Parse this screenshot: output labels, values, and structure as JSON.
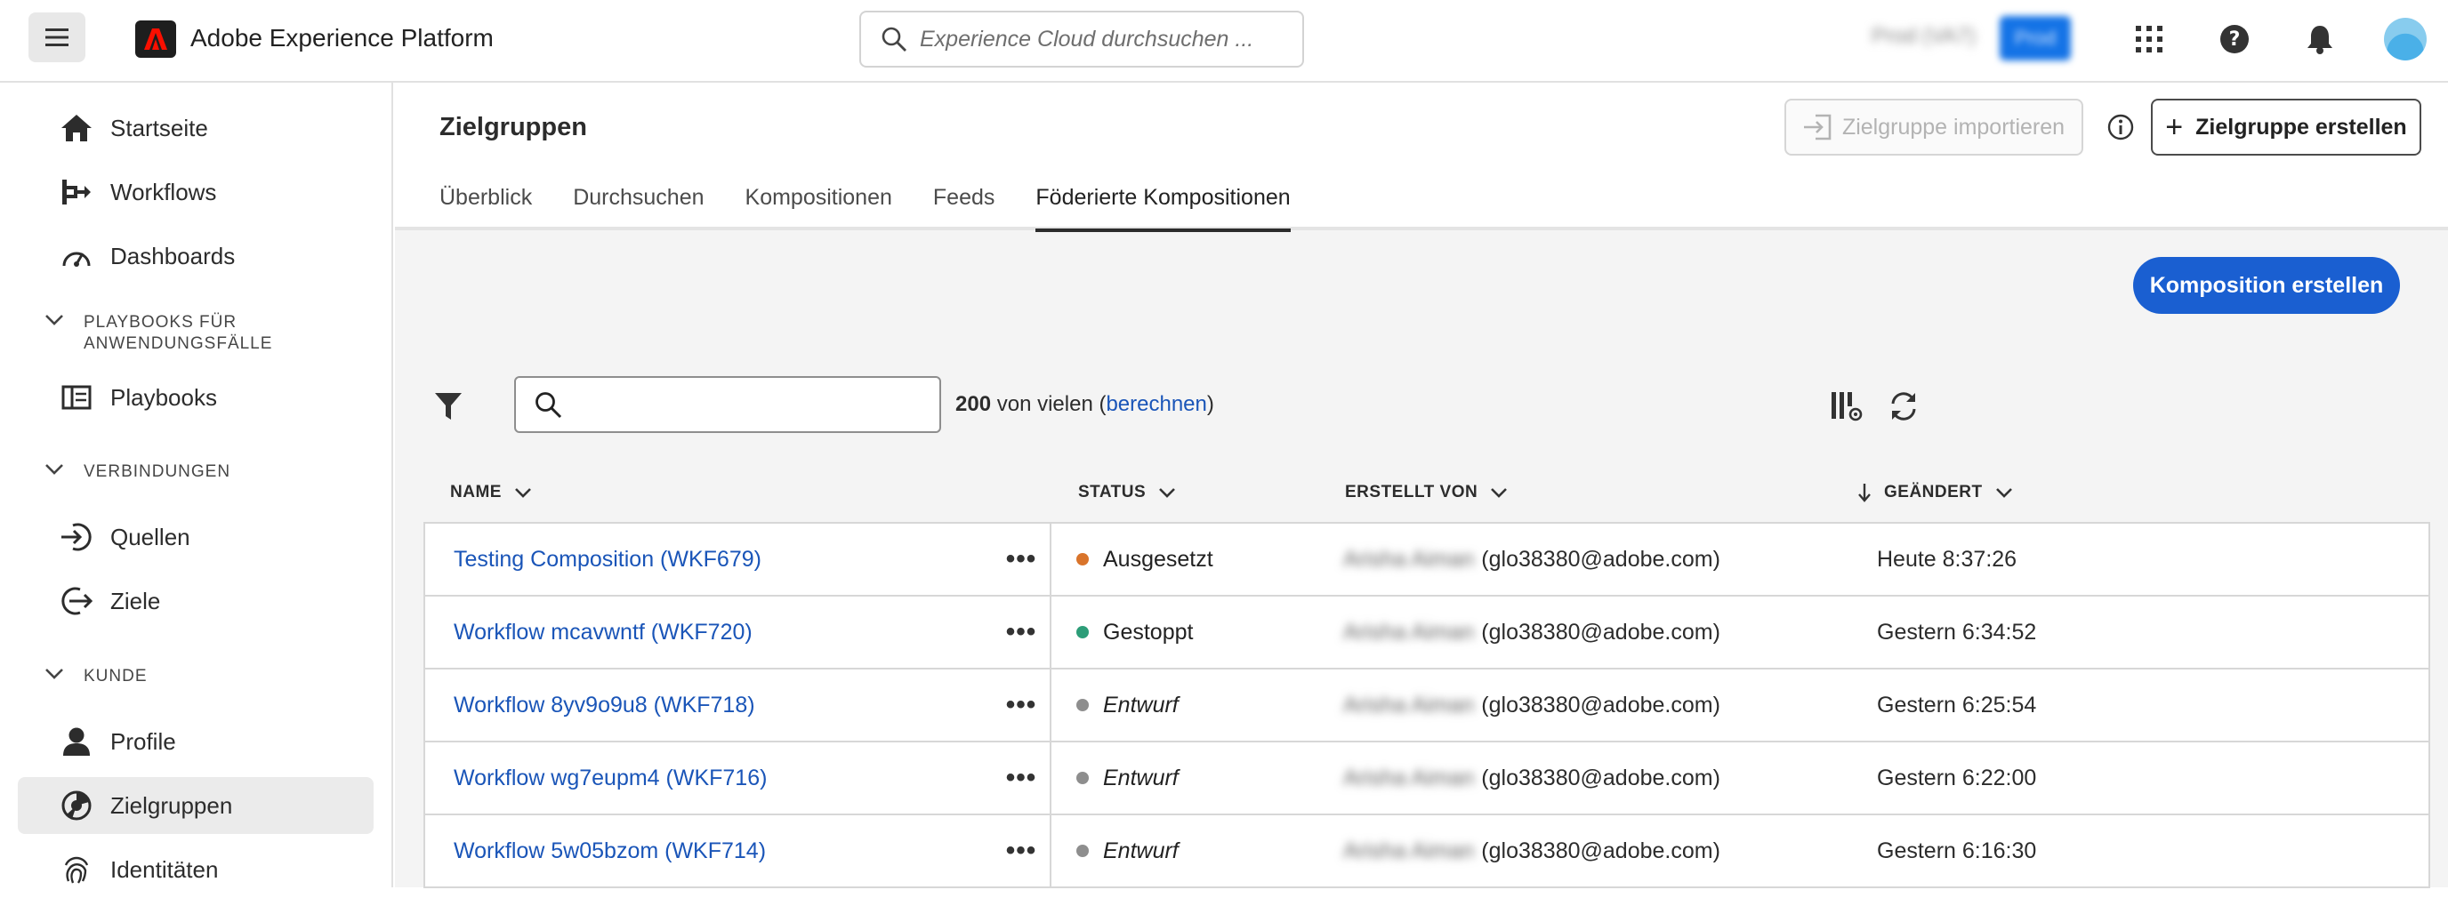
{
  "app": {
    "title": "Adobe Experience Platform"
  },
  "topbar": {
    "search_placeholder": "Experience Cloud durchsuchen ...",
    "org_label": "Prod (VA7)",
    "org_badge": "Prod"
  },
  "sidebar": {
    "items": [
      {
        "label": "Startseite",
        "icon": "home-icon"
      },
      {
        "label": "Workflows",
        "icon": "workflow-icon"
      },
      {
        "label": "Dashboards",
        "icon": "dashboard-icon"
      }
    ],
    "section_playbooks": "PLAYBOOKS FÜR ANWENDUNGSFÄLLE",
    "playbooks": {
      "label": "Playbooks",
      "icon": "playbook-icon"
    },
    "section_connections": "VERBINDUNGEN",
    "sources": {
      "label": "Quellen",
      "icon": "sources-icon"
    },
    "destinations": {
      "label": "Ziele",
      "icon": "destinations-icon"
    },
    "section_customer": "KUNDE",
    "profiles": {
      "label": "Profile",
      "icon": "profile-icon"
    },
    "audiences": {
      "label": "Zielgruppen",
      "icon": "audiences-icon"
    },
    "identities": {
      "label": "Identitäten",
      "icon": "fingerprint-icon"
    }
  },
  "main": {
    "title": "Zielgruppen",
    "import_label": "Zielgruppe importieren",
    "create_audience_label": "Zielgruppe erstellen",
    "tabs": [
      {
        "label": "Überblick"
      },
      {
        "label": "Durchsuchen"
      },
      {
        "label": "Kompositionen"
      },
      {
        "label": "Feeds"
      },
      {
        "label": "Föderierte Kompositionen"
      }
    ],
    "active_tab": "Föderierte Kompositionen",
    "create_composition_label": "Komposition erstellen",
    "count_bold": "200",
    "count_text": " von vielen (",
    "count_link": "berechnen",
    "count_close": ")",
    "columns": {
      "name": "NAME",
      "status": "STATUS",
      "created_by": "ERSTELLT VON",
      "changed": "GEÄNDERT"
    },
    "rows": [
      {
        "name": "Testing Composition (WKF679)",
        "status": "Ausgesetzt",
        "status_color": "#d9742b",
        "italic": false,
        "creator_name": "Arisha Aiman",
        "creator_email": "(glo38380@adobe.com)",
        "changed": "Heute 8:37:26"
      },
      {
        "name": "Workflow mcavwntf (WKF720)",
        "status": "Gestoppt",
        "status_color": "#2d9d78",
        "italic": false,
        "creator_name": "Arisha Aiman",
        "creator_email": "(glo38380@adobe.com)",
        "changed": "Gestern 6:34:52"
      },
      {
        "name": "Workflow 8yv9o9u8 (WKF718)",
        "status": "Entwurf",
        "status_color": "#8e8e8e",
        "italic": true,
        "creator_name": "Arisha Aiman",
        "creator_email": "(glo38380@adobe.com)",
        "changed": "Gestern 6:25:54"
      },
      {
        "name": "Workflow wg7eupm4 (WKF716)",
        "status": "Entwurf",
        "status_color": "#8e8e8e",
        "italic": true,
        "creator_name": "Arisha Aiman",
        "creator_email": "(glo38380@adobe.com)",
        "changed": "Gestern 6:22:00"
      },
      {
        "name": "Workflow 5w05bzom (WKF714)",
        "status": "Entwurf",
        "status_color": "#8e8e8e",
        "italic": true,
        "creator_name": "Arisha Aiman",
        "creator_email": "(glo38380@adobe.com)",
        "changed": "Gestern 6:16:30"
      }
    ]
  }
}
